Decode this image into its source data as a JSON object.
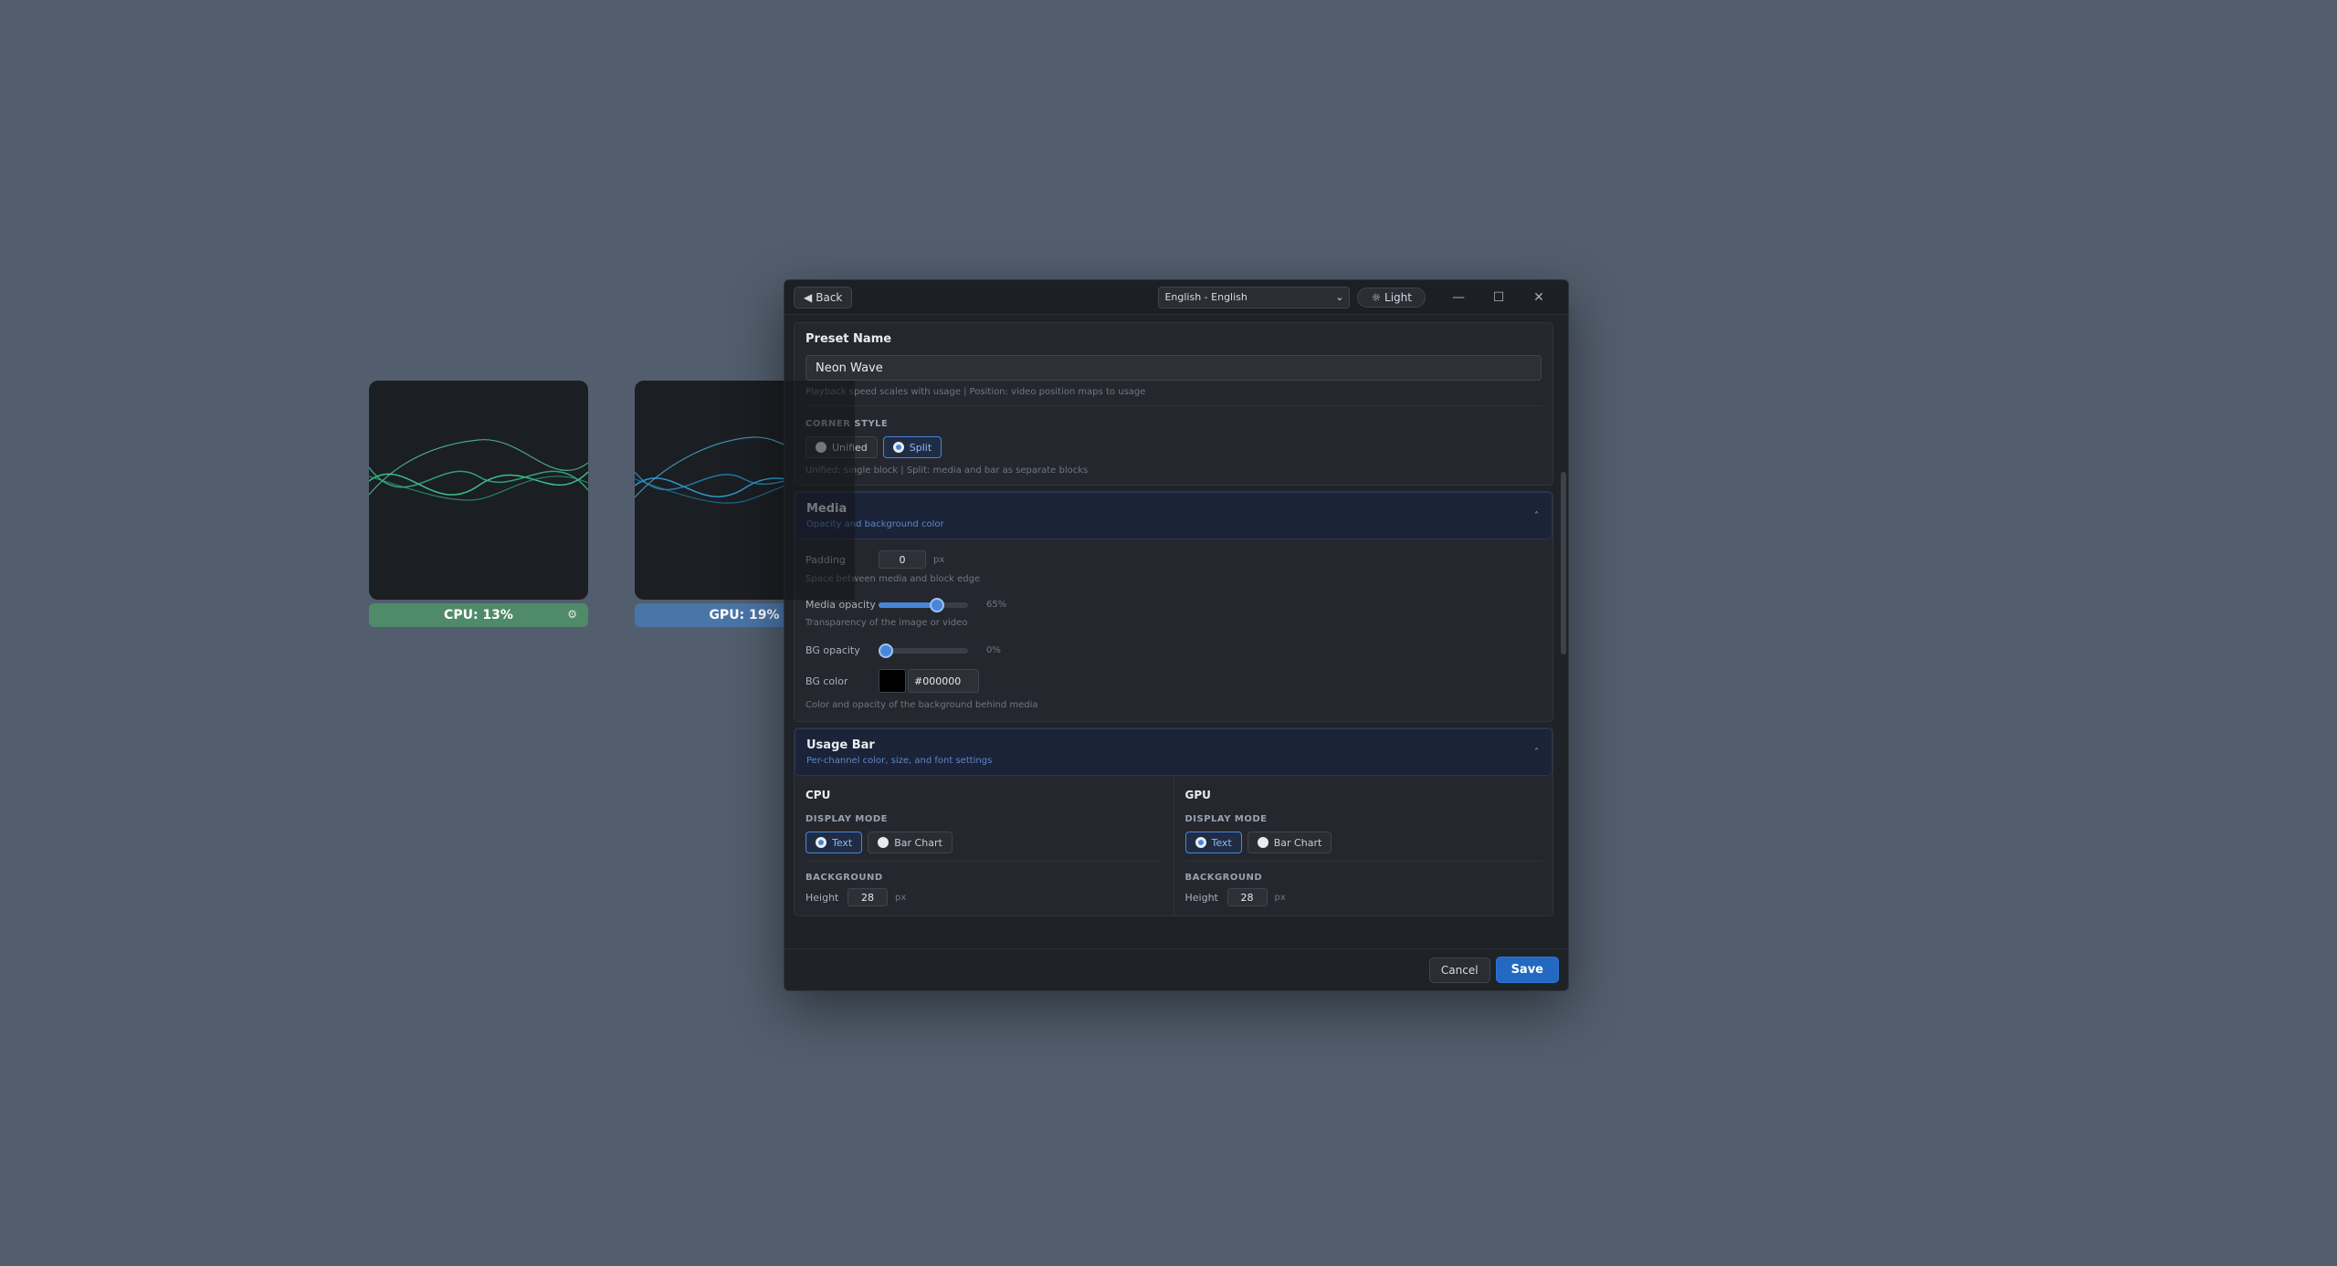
{
  "widgets": {
    "cpu": {
      "label": "CPU: 13%",
      "wave_color": "#3fd19a",
      "bar_color": "#4f8a69"
    },
    "gpu": {
      "label": "GPU: 19%",
      "wave_color": "#2fa8e0",
      "bar_color": "#4a75a8"
    }
  },
  "titlebar": {
    "back_label": "Back",
    "language": "English - English",
    "theme_label": "☼ Light"
  },
  "preset": {
    "title": "Preset Name",
    "value": "Neon Wave",
    "partial_hint": "Playback speed scales with usage | Position: video position maps to usage"
  },
  "corner_style": {
    "label": "CORNER STYLE",
    "options": [
      "Unified",
      "Split"
    ],
    "selected": "Split",
    "hint": "Unified: single block | Split: media and bar as separate blocks"
  },
  "media": {
    "title": "Media",
    "subtitle": "Opacity and background color",
    "padding_label": "Padding",
    "padding_value": "0",
    "padding_unit": "px",
    "padding_hint": "Space between media and block edge",
    "opacity_label": "Media opacity",
    "opacity_value": 65,
    "opacity_text": "65%",
    "opacity_hint": "Transparency of the image or video",
    "bg_opacity_label": "BG opacity",
    "bg_opacity_value": 0,
    "bg_opacity_text": "0%",
    "bg_color_label": "BG color",
    "bg_color_value": "#000000",
    "bg_hint": "Color and opacity of the background behind media"
  },
  "usage_bar": {
    "title": "Usage Bar",
    "subtitle": "Per-channel color, size, and font settings",
    "channels": [
      {
        "name": "CPU",
        "display_mode_label": "DISPLAY MODE",
        "options": [
          "Text",
          "Bar Chart"
        ],
        "selected": "Text",
        "background_label": "BACKGROUND",
        "height_label": "Height",
        "height_value": "28",
        "height_unit": "px"
      },
      {
        "name": "GPU",
        "display_mode_label": "DISPLAY MODE",
        "options": [
          "Text",
          "Bar Chart"
        ],
        "selected": "Text",
        "background_label": "BACKGROUND",
        "height_label": "Height",
        "height_value": "28",
        "height_unit": "px"
      }
    ]
  },
  "footer": {
    "cancel_label": "Cancel",
    "save_label": "Save"
  },
  "colors": {
    "accent": "#2369c2",
    "background": "#525e6d",
    "dialog": "#1f2227"
  }
}
